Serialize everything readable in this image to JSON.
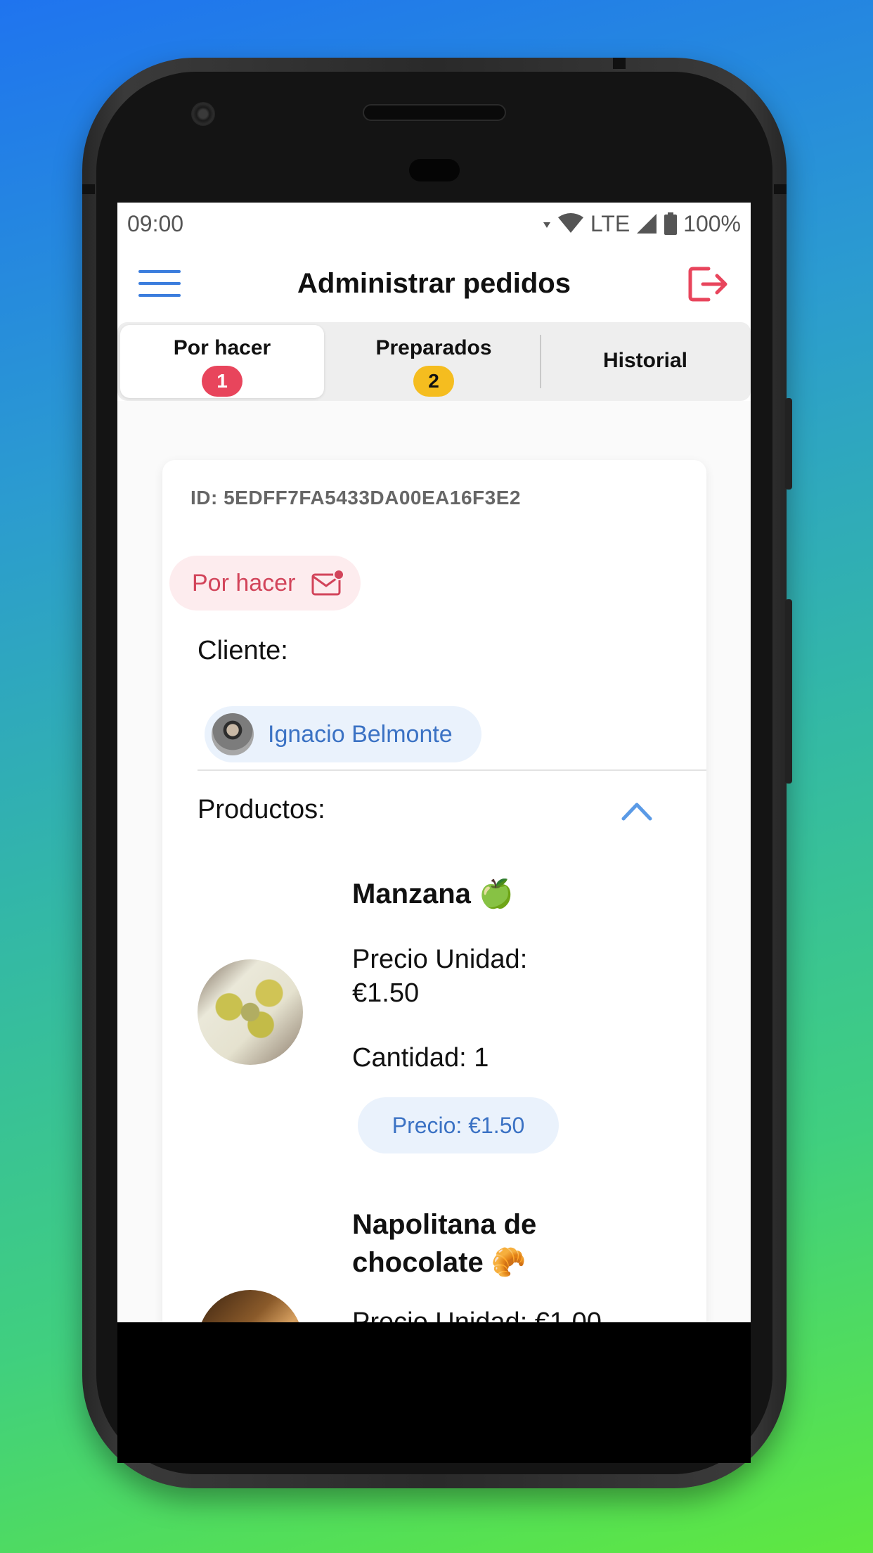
{
  "status_bar": {
    "time": "09:00",
    "network": "LTE",
    "battery": "100%"
  },
  "app_bar": {
    "title": "Administrar pedidos"
  },
  "tabs": [
    {
      "label": "Por hacer",
      "badge": "1",
      "badge_color": "#e8455c",
      "active": true
    },
    {
      "label": "Preparados",
      "badge": "2",
      "badge_color": "#f5bd1f",
      "active": false
    },
    {
      "label": "Historial",
      "active": false
    }
  ],
  "order": {
    "id_text": "ID: 5EDFF7FA5433DA00EA16F3E2",
    "status_label": "Por hacer",
    "client_label": "Cliente:",
    "client_name": "Ignacio Belmonte",
    "products_label": "Productos:",
    "products": [
      {
        "name": "Manzana 🍏",
        "unit_price_label": "Precio Unidad:",
        "unit_price": "€1.50",
        "quantity_text": "Cantidad: 1",
        "price_text": "Precio: €1.50"
      },
      {
        "name": "Napolitana de chocolate 🥐",
        "unit_price_text": "Precio Unidad: €1.00"
      }
    ]
  },
  "colors": {
    "accent_blue": "#3b7ddd",
    "danger_red": "#e8455c",
    "warning_yellow": "#f5bd1f"
  }
}
